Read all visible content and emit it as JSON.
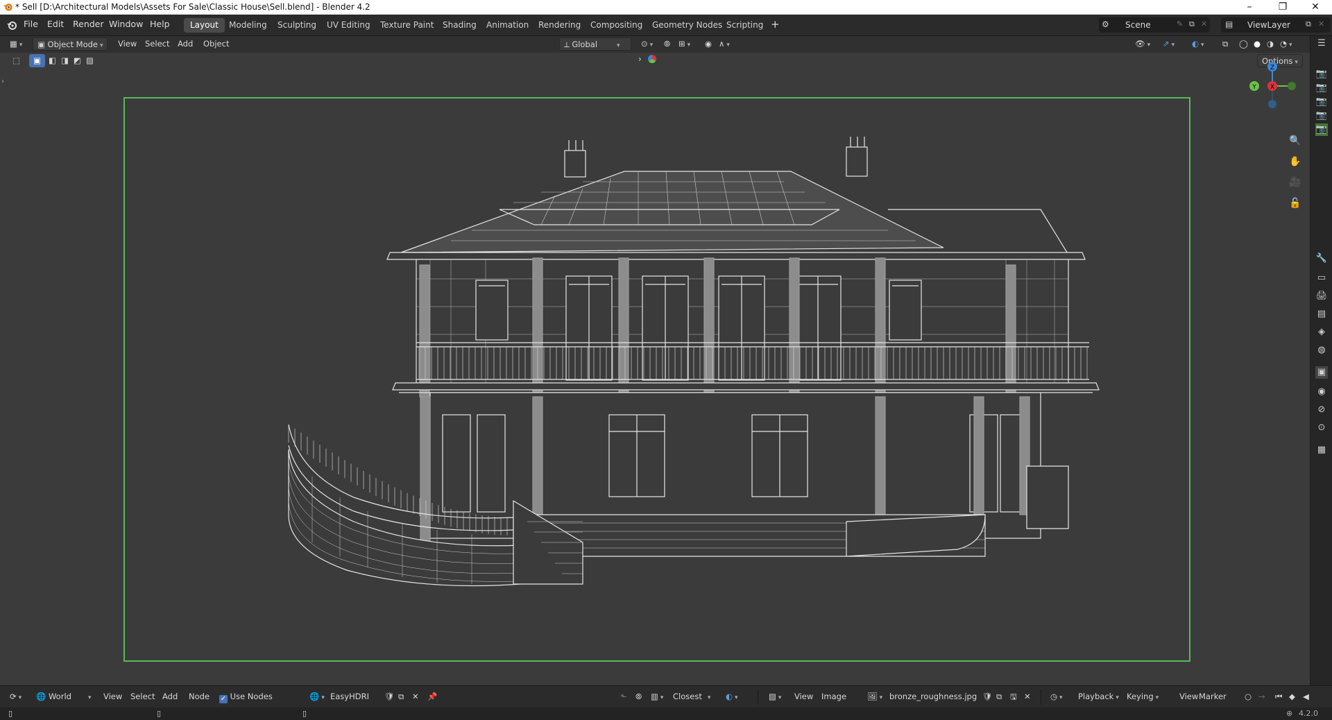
{
  "window": {
    "title": "* Sell [D:\\Architectural Models\\Assets For Sale\\Classic House\\Sell.blend] - Blender 4.2",
    "minimize": "–",
    "restore": "❐",
    "close": "✕"
  },
  "menus": [
    "File",
    "Edit",
    "Render",
    "Window",
    "Help"
  ],
  "workspaces": [
    "Layout",
    "Modeling",
    "Sculpting",
    "UV Editing",
    "Texture Paint",
    "Shading",
    "Animation",
    "Rendering",
    "Compositing",
    "Geometry Nodes",
    "Scripting"
  ],
  "workspace_add": "+",
  "scene": {
    "label": "Scene",
    "view_layer": "ViewLayer"
  },
  "viewport_header": {
    "mode": "Object Mode",
    "menus": [
      "View",
      "Select",
      "Add",
      "Object"
    ],
    "transform_orientation": "Global",
    "options": "Options"
  },
  "gizmo": {
    "z": "Z",
    "y": "Y",
    "x": "X"
  },
  "bottom": {
    "shader_type": "World",
    "menus": [
      "View",
      "Select",
      "Add",
      "Node"
    ],
    "use_nodes": "Use Nodes",
    "world_name": "EasyHDRI",
    "snap": "Closest",
    "image_menus": [
      "View",
      "Image"
    ],
    "image_name": "bronze_roughness.jpg",
    "timeline_menus": [
      "Playback",
      "Keying",
      "View",
      "Marker"
    ]
  },
  "status": {
    "version": "4.2.0"
  },
  "colors": {
    "camera_frame": "#59b85c",
    "axis_x": "#d9343a",
    "axis_y": "#6ac248",
    "axis_z": "#3b86d9",
    "accent": "#4772b3"
  },
  "icons": [
    "blender-logo",
    "editor-type-icon",
    "select-box-icon",
    "cursor-icon",
    "transform-pivot-icon",
    "snap-icon",
    "proportional-icon",
    "visibility-icon",
    "gizmo-icon",
    "overlay-icon",
    "xray-icon",
    "shading-wireframe-icon",
    "shading-solid-icon",
    "shading-material-icon",
    "shading-rendered-icon",
    "zoom-icon",
    "hand-icon",
    "camera-icon",
    "lock-icon",
    "pin-icon",
    "close-icon"
  ]
}
